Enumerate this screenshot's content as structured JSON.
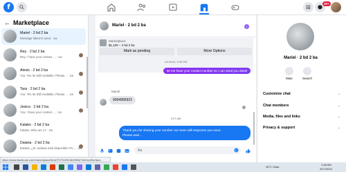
{
  "topbar": {
    "logo": "f",
    "notification_count": "20+"
  },
  "left": {
    "title": "Marketplace",
    "back_icon": "←",
    "conversations": [
      {
        "name": "Mariel · 2 bd 2 ba",
        "preview": "Message failed to send · 1w",
        "active": true
      },
      {
        "name": "Rey · 2 bd 2 ba",
        "preview": "Rey: I have your contact ... · 1w",
        "active": false
      },
      {
        "name": "Alexis · 2 bd 2 ba",
        "preview": "You: Yes Its Still Available, Please... · 1w",
        "active": false
      },
      {
        "name": "Tara · 2 bd 2 ba",
        "preview": "You: Yes Its Still Available, Please... · 1w",
        "active": false
      },
      {
        "name": "Jesica · 2 bd 2 ba",
        "preview": "You: I have your contact ... · 1w",
        "active": false
      },
      {
        "name": "Kalako · 2 bd 2 ba",
        "preview": "Kalako: Who are u? · 2w",
        "active": false
      },
      {
        "name": "Daiana · 2 bd 2 ba",
        "preview": "Daiana: ¿Si, todavia está disponible! Po... · 3w",
        "active": false
      }
    ]
  },
  "chat": {
    "title": "Mariel · 2 bd 2 ba",
    "listing_label": "Marketplace",
    "listing_price": "$1,100 – 2 bd 2 ba",
    "mark_pending": "Mark as pending",
    "more_options": "More Options",
    "timestamp1": "10/15/23, 9:39 PM",
    "outgoing1": "let me have your contact number so i can send you detail",
    "sender": "Mariel",
    "incoming1": "9094956923",
    "timestamp2": "3:07 AM",
    "outgoing2_line1": "Thank you for sharing your number our team will response you soon.",
    "outgoing2_line2": "Please wait...",
    "composer_placeholder": "Aa"
  },
  "right": {
    "name": "Mariel · 2 bd 2 ba",
    "mute": "Mute",
    "search": "Search",
    "items": [
      "Customize chat",
      "Chat members",
      "Media, files and links",
      "Privacy & support"
    ]
  },
  "status_url": "https://www.facebook.com/marketplace/item/707913921849056/?referralSurface...",
  "taskbar": {
    "weather": "26°C  Clear",
    "time": "1:08 AM",
    "date": "4/17/2024"
  },
  "colors": {
    "brand": "#1877f2",
    "outgoing_purple": "#8d2ff1",
    "badge_red": "#e41e3f"
  }
}
